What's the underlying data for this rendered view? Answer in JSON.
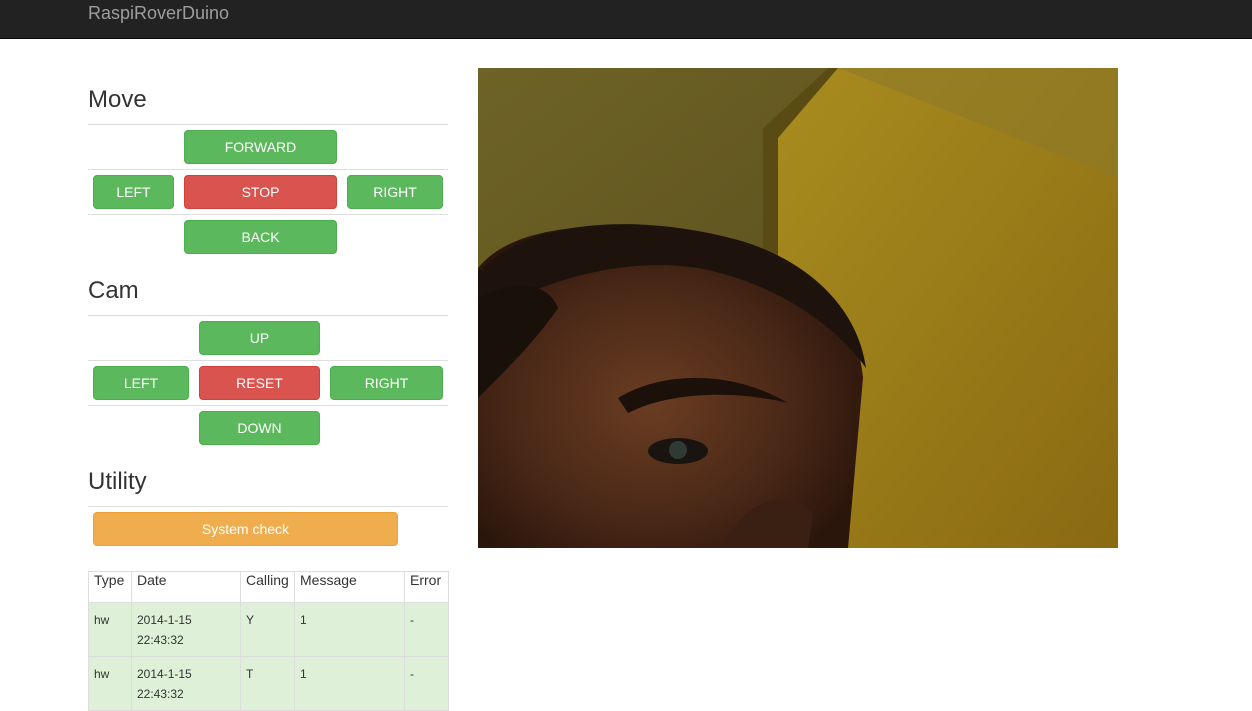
{
  "navbar": {
    "brand": "RaspiRoverDuino"
  },
  "move": {
    "title": "Move",
    "forward": "FORWARD",
    "left": "LEFT",
    "stop": "STOP",
    "right": "RIGHT",
    "back": "BACK"
  },
  "cam": {
    "title": "Cam",
    "up": "UP",
    "left": "LEFT",
    "reset": "RESET",
    "right": "RIGHT",
    "down": "DOWN"
  },
  "utility": {
    "title": "Utility",
    "system_check": "System check"
  },
  "log": {
    "headers": [
      "Type",
      "Date",
      "Calling",
      "Message",
      "Error"
    ],
    "rows": [
      [
        "hw",
        "2014-1-15 22:43:32",
        "Y",
        "1",
        "-"
      ],
      [
        "hw",
        "2014-1-15 22:43:32",
        "T",
        "1",
        "-"
      ]
    ]
  },
  "colors": {
    "success": "#5cb85c",
    "danger": "#d9534f",
    "warning": "#f0ad4e",
    "navbar": "#222222",
    "row_success": "#dff0d8"
  }
}
